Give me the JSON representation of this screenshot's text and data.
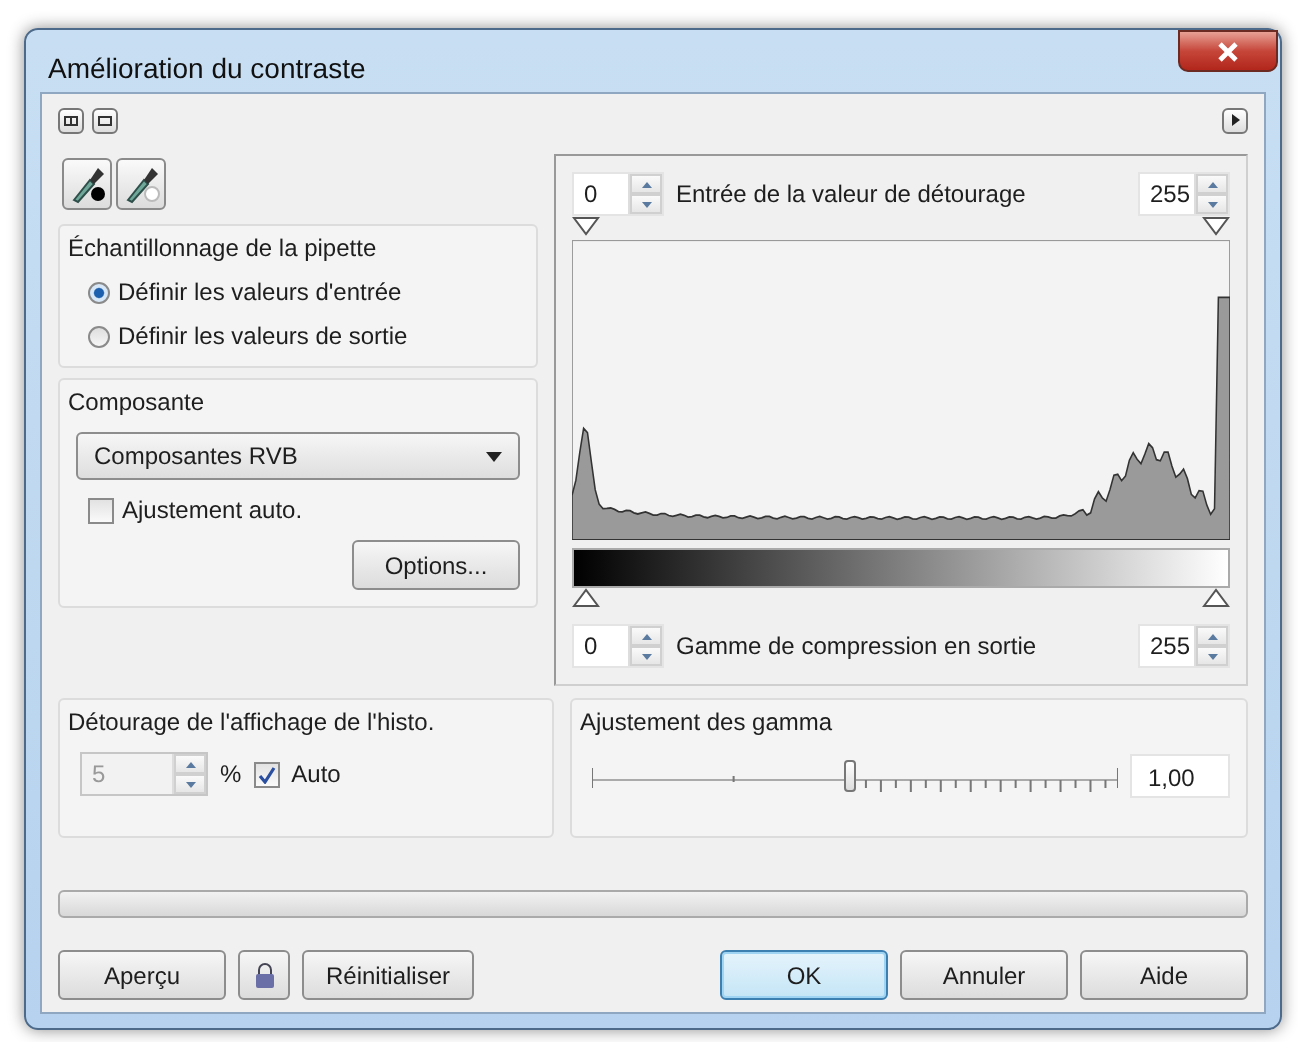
{
  "window": {
    "title": "Amélioration du contraste"
  },
  "sampling": {
    "title": "Échantillonnage de la pipette",
    "options": [
      {
        "label": "Définir les valeurs d'entrée",
        "selected": true
      },
      {
        "label": "Définir les valeurs de sortie",
        "selected": false
      }
    ]
  },
  "component": {
    "title": "Composante",
    "dropdown": "Composantes RVB",
    "auto_adjust": {
      "label": "Ajustement auto.",
      "checked": false
    },
    "options_button": "Options..."
  },
  "input_clip": {
    "label": "Entrée de la valeur de détourage",
    "low": "0",
    "high": "255"
  },
  "output_range": {
    "label": "Gamme de compression en sortie",
    "low": "0",
    "high": "255"
  },
  "histo_clip": {
    "title": "Détourage de l'affichage de l'histo.",
    "value": "5",
    "disabled": true,
    "unit": "%",
    "auto": {
      "label": "Auto",
      "checked": true
    }
  },
  "gamma": {
    "title": "Ajustement des gamma",
    "level": 0.49,
    "value": "1,00"
  },
  "progress": {
    "level": 0
  },
  "buttons_left": [
    "Aperçu",
    "Réinitialiser"
  ],
  "buttons_right": [
    {
      "label": "OK",
      "default": true
    },
    {
      "label": "Annuler",
      "default": false
    },
    {
      "label": "Aide",
      "default": false
    }
  ]
}
